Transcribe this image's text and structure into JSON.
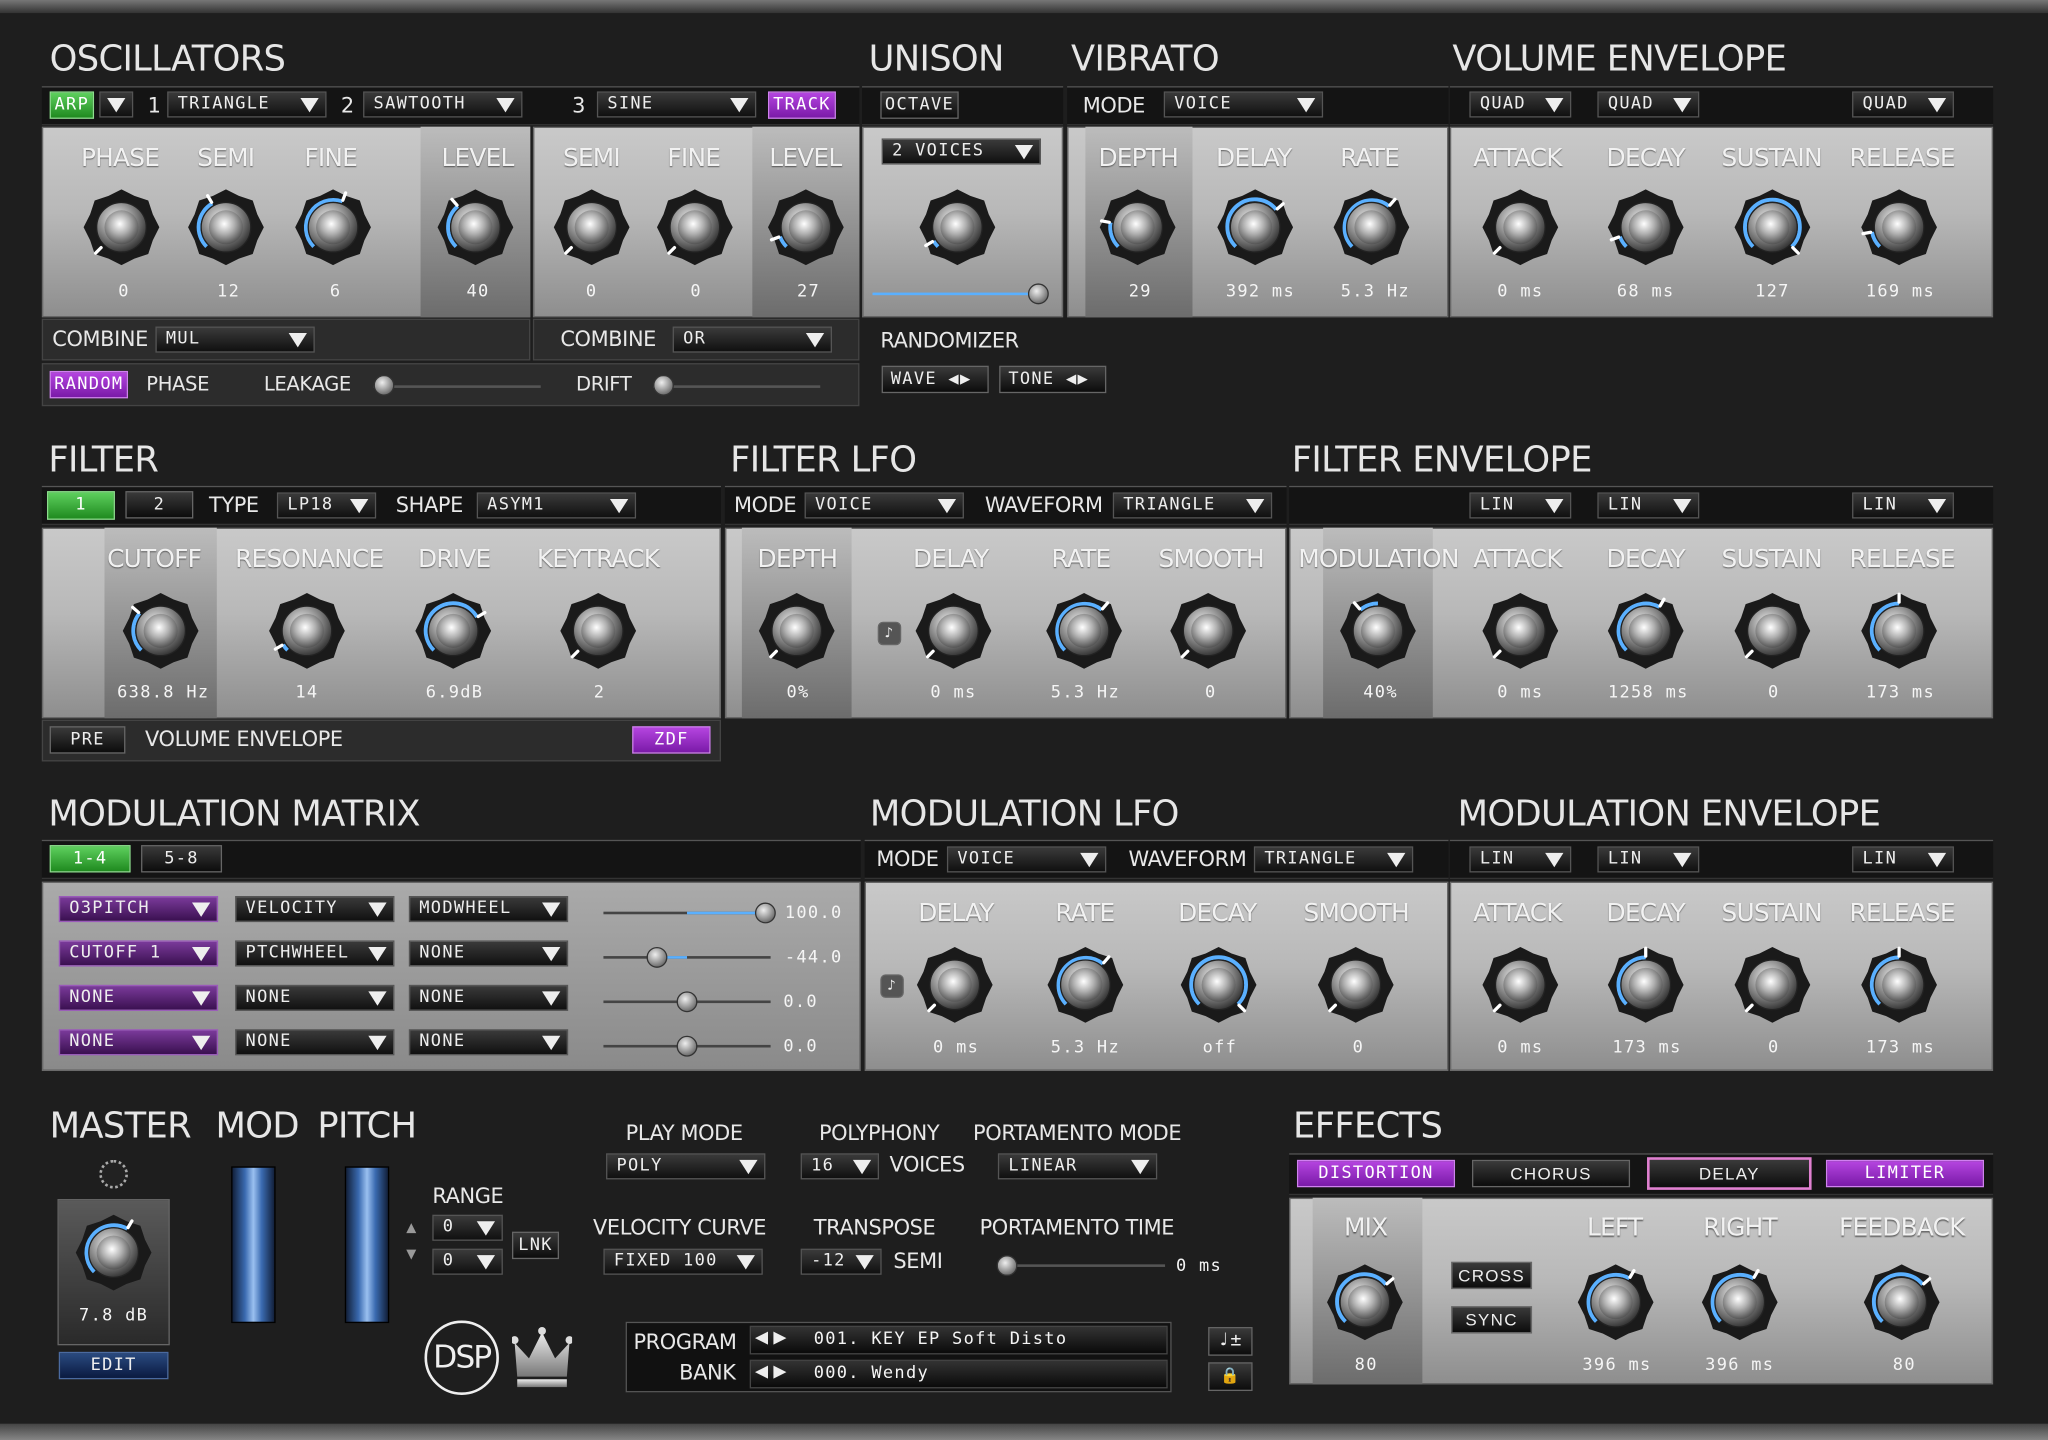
{
  "oscillators": {
    "title": "OSCILLATORS",
    "arp": "ARP",
    "osc1_num": "1",
    "osc1_wave": "TRIANGLE",
    "osc2_num": "2",
    "osc2_wave": "SAWTOOTH",
    "osc3_num": "3",
    "osc3_wave": "SINE",
    "track": "TRACK",
    "labels": {
      "phase": "PHASE",
      "semi": "SEMI",
      "fine": "FINE",
      "level": "LEVEL",
      "semi2": "SEMI",
      "fine2": "FINE",
      "level2": "LEVEL"
    },
    "values": {
      "phase": "0",
      "semi": "12",
      "fine": "6",
      "level": "40",
      "semi2": "0",
      "fine2": "0",
      "level2": "27"
    },
    "combine_label": "COMBINE",
    "combine1": "MUL",
    "combine2_label": "COMBINE",
    "combine2": "OR",
    "random": "RANDOM",
    "phase_label": "PHASE",
    "leakage": "LEAKAGE",
    "drift": "DRIFT"
  },
  "unison": {
    "title": "UNISON",
    "octave": "OCTAVE",
    "voices": "2 VOICES",
    "randomizer": "RANDOMIZER",
    "wave": "WAVE",
    "tone": "TONE"
  },
  "vibrato": {
    "title": "VIBRATO",
    "mode_label": "MODE",
    "mode": "VOICE",
    "depth": "DEPTH",
    "delay": "DELAY",
    "rate": "RATE",
    "depth_val": "29",
    "delay_val": "392 ms",
    "rate_val": "5.3 Hz"
  },
  "volume_env": {
    "title": "VOLUME ENVELOPE",
    "curve1": "QUAD",
    "curve2": "QUAD",
    "curve3": "QUAD",
    "attack": "ATTACK",
    "decay": "DECAY",
    "sustain": "SUSTAIN",
    "release": "RELEASE",
    "attack_val": "0 ms",
    "decay_val": "68 ms",
    "sustain_val": "127",
    "release_val": "169 ms"
  },
  "filter": {
    "title": "FILTER",
    "f1": "1",
    "f2": "2",
    "type_label": "TYPE",
    "type": "LP18",
    "shape_label": "SHAPE",
    "shape": "ASYM1",
    "cutoff": "CUTOFF",
    "resonance": "RESONANCE",
    "drive": "DRIVE",
    "keytrack": "KEYTRACK",
    "cutoff_val": "638.8 Hz",
    "resonance_val": "14",
    "drive_val": "6.9dB",
    "keytrack_val": "2",
    "pre": "PRE",
    "env": "VOLUME ENVELOPE",
    "zdf": "ZDF"
  },
  "filter_lfo": {
    "title": "FILTER LFO",
    "mode_label": "MODE",
    "mode": "VOICE",
    "waveform_label": "WAVEFORM",
    "waveform": "TRIANGLE",
    "depth": "DEPTH",
    "delay": "DELAY",
    "rate": "RATE",
    "smooth": "SMOOTH",
    "depth_val": "0%",
    "delay_val": "0 ms",
    "rate_val": "5.3 Hz",
    "smooth_val": "0"
  },
  "filter_env": {
    "title": "FILTER ENVELOPE",
    "curve1": "LIN",
    "curve2": "LIN",
    "curve3": "LIN",
    "modulation": "MODULATION",
    "attack": "ATTACK",
    "decay": "DECAY",
    "sustain": "SUSTAIN",
    "release": "RELEASE",
    "modulation_val": "40%",
    "attack_val": "0 ms",
    "decay_val": "1258 ms",
    "sustain_val": "0",
    "release_val": "173 ms"
  },
  "mod_matrix": {
    "title": "MODULATION MATRIX",
    "tab1": "1-4",
    "tab2": "5-8",
    "rows": [
      {
        "dest": "O3PITCH",
        "src": "VELOCITY",
        "via": "MODWHEEL",
        "amount": "100.0"
      },
      {
        "dest": "CUTOFF 1",
        "src": "PTCHWHEEL",
        "via": "NONE",
        "amount": "-44.0"
      },
      {
        "dest": "NONE",
        "src": "NONE",
        "via": "NONE",
        "amount": "0.0"
      },
      {
        "dest": "NONE",
        "src": "NONE",
        "via": "NONE",
        "amount": "0.0"
      }
    ]
  },
  "mod_lfo": {
    "title": "MODULATION LFO",
    "mode_label": "MODE",
    "mode": "VOICE",
    "waveform_label": "WAVEFORM",
    "waveform": "TRIANGLE",
    "delay": "DELAY",
    "rate": "RATE",
    "decay": "DECAY",
    "smooth": "SMOOTH",
    "delay_val": "0 ms",
    "rate_val": "5.3 Hz",
    "decay_val": "off",
    "smooth_val": "0"
  },
  "mod_env": {
    "title": "MODULATION ENVELOPE",
    "curve1": "LIN",
    "curve2": "LIN",
    "curve3": "LIN",
    "attack": "ATTACK",
    "decay": "DECAY",
    "sustain": "SUSTAIN",
    "release": "RELEASE",
    "attack_val": "0 ms",
    "decay_val": "173 ms",
    "sustain_val": "0",
    "release_val": "173 ms"
  },
  "master": {
    "title": "MASTER",
    "mod": "MOD",
    "pitch": "PITCH",
    "value": "7.8 dB",
    "edit": "EDIT",
    "range": "RANGE",
    "range_up": "0",
    "range_down": "0",
    "lnk": "LNK"
  },
  "play": {
    "play_mode_label": "PLAY MODE",
    "play_mode": "POLY",
    "polyphony_label": "POLYPHONY",
    "polyphony": "16",
    "voices": "VOICES",
    "porta_mode_label": "PORTAMENTO MODE",
    "porta_mode": "LINEAR",
    "vel_label": "VELOCITY CURVE",
    "vel": "FIXED 100",
    "transpose_label": "TRANSPOSE",
    "transpose": "-12",
    "semi": "SEMI",
    "porta_time_label": "PORTAMENTO TIME",
    "porta_time": "0 ms"
  },
  "program": {
    "logo": "DSP",
    "program_label": "PROGRAM",
    "bank_label": "BANK",
    "program": "001. KEY EP Soft Disto",
    "bank": "000. Wendy"
  },
  "effects": {
    "title": "EFFECTS",
    "tabs": [
      "DISTORTION",
      "CHORUS",
      "DELAY",
      "LIMITER"
    ],
    "mix": "MIX",
    "left": "LEFT",
    "right": "RIGHT",
    "feedback": "FEEDBACK",
    "cross": "CROSS",
    "sync": "SYNC",
    "mix_val": "80",
    "left_val": "396 ms",
    "right_val": "396 ms",
    "feedback_val": "80"
  },
  "colors": {
    "accent_green": "#3cb83c",
    "accent_violet": "#9a30c8",
    "knob_arc": "#5ab0ff"
  }
}
